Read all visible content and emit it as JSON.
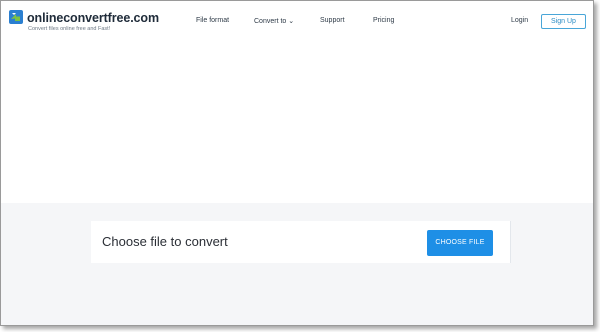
{
  "brand": {
    "name": "onlineconvertfree.com",
    "tagline": "Convert files online free and Fast!",
    "colors": {
      "primary": "#1e8fe6",
      "signup_border": "#49a6d8",
      "logo_green": "#7cc242",
      "logo_blue": "#2b7fd0"
    }
  },
  "nav": {
    "items": [
      {
        "label": "File format"
      },
      {
        "label": "Convert to",
        "icon": "chevron-down-icon"
      },
      {
        "label": "Support"
      },
      {
        "label": "Pricing"
      }
    ],
    "login_label": "Login",
    "signup_label": "Sign Up"
  },
  "upload": {
    "prompt": "Choose file to convert",
    "button_label": "CHOOSE FILE"
  }
}
